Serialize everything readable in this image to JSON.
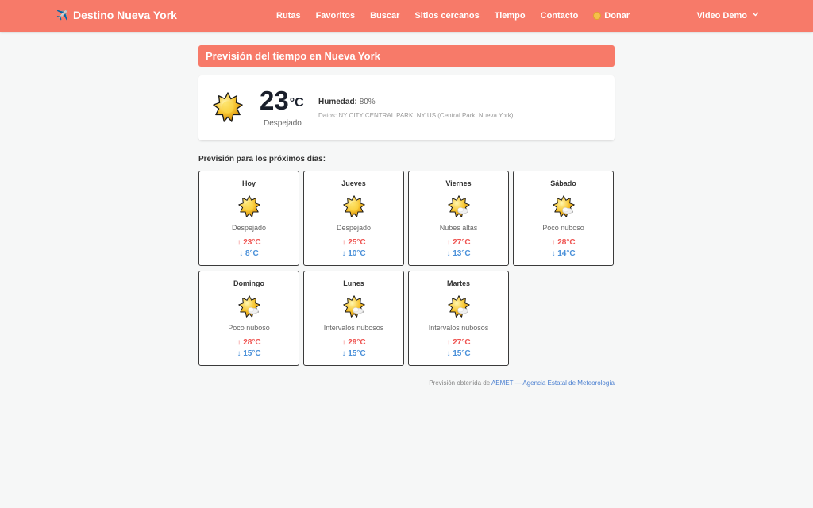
{
  "header": {
    "brand": "Destino Nueva York",
    "nav": [
      "Rutas",
      "Favoritos",
      "Buscar",
      "Sitios cercanos",
      "Tiempo",
      "Contacto",
      "Donar"
    ],
    "user": "Video Demo"
  },
  "main": {
    "banner": "Previsión del tiempo en Nueva York",
    "current": {
      "temp": "23",
      "unit": "°C",
      "condition": "Despejado",
      "humidity_label": "Humedad:",
      "humidity_value": "80%",
      "source": "Datos: NY CITY CENTRAL PARK, NY US (Central Park, Nueva York)"
    },
    "forecast_title": "Previsión para los próximos días:",
    "days": [
      {
        "name": "Hoy",
        "condition": "Despejado",
        "max": "↑ 23°C",
        "min": "↓ 8°C",
        "icon": "sun-icon"
      },
      {
        "name": "Jueves",
        "condition": "Despejado",
        "max": "↑ 25°C",
        "min": "↓ 10°C",
        "icon": "sun-icon"
      },
      {
        "name": "Viernes",
        "condition": "Nubes altas",
        "max": "↑ 27°C",
        "min": "↓ 13°C",
        "icon": "sun-cloud-icon"
      },
      {
        "name": "Sábado",
        "condition": "Poco nuboso",
        "max": "↑ 28°C",
        "min": "↓ 14°C",
        "icon": "sun-cloud-icon"
      },
      {
        "name": "Domingo",
        "condition": "Poco nuboso",
        "max": "↑ 28°C",
        "min": "↓ 15°C",
        "icon": "sun-cloud-icon"
      },
      {
        "name": "Lunes",
        "condition": "Intervalos nubosos",
        "max": "↑ 29°C",
        "min": "↓ 15°C",
        "icon": "sun-cloud-icon"
      },
      {
        "name": "Martes",
        "condition": "Intervalos nubosos",
        "max": "↑ 27°C",
        "min": "↓ 15°C",
        "icon": "sun-cloud-icon"
      }
    ]
  },
  "footer": {
    "prefix": "Previsión obtenida de",
    "link": "AEMET — Agencia Estatal de Meteorología"
  },
  "colors": {
    "accent": "#f77a69",
    "max_temp": "#ef5350",
    "min_temp": "#4a90d9"
  }
}
